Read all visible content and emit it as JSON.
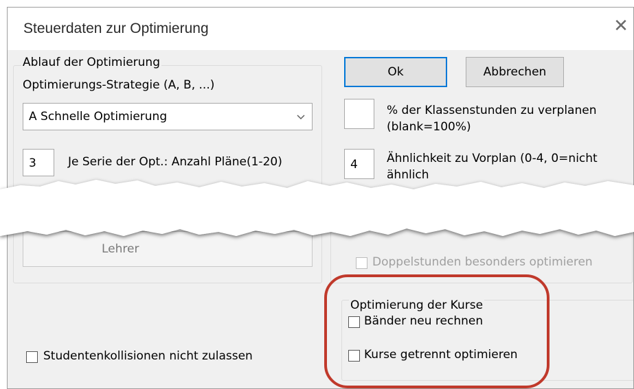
{
  "dialog": {
    "title": "Steuerdaten zur Optimierung",
    "close_glyph": "✕"
  },
  "ablauf_group": {
    "legend": "Ablauf der Optimierung",
    "strategy_label": "Optimierungs-Strategie (A, B, ...)",
    "strategy_value": "A Schnelle Optimierung",
    "plans_value": "3",
    "plans_label": "Je Serie der Opt.: Anzahl Pläne(1-20)",
    "lehrer_button_partial": "Lehrer"
  },
  "buttons": {
    "ok": "Ok",
    "cancel": "Abbrechen"
  },
  "klassenstunden": {
    "value": "",
    "label_line1": "% der Klassenstunden zu verplanen",
    "label_line2": "(blank=100%)"
  },
  "aehnlichkeit": {
    "value": "4",
    "label_line1": "Ähnlichkeit zu Vorplan (0-4, 0=nicht",
    "label_line2_partial": "ähnlich"
  },
  "doppelstunden": {
    "label": "Doppelstunden besonders optimieren",
    "checked": false,
    "enabled": false
  },
  "kurse_group": {
    "legend": "Optimierung der Kurse",
    "baender": {
      "label": "Bänder neu rechnen",
      "checked": false
    },
    "getrennt": {
      "label": "Kurse getrennt optimieren",
      "checked": false
    }
  },
  "studenten": {
    "label": "Studentenkollisionen nicht zulassen",
    "checked": false
  },
  "colors": {
    "dialog_bg": "#f0f0f0",
    "highlight": "#c0392b",
    "default_button_border": "#0078d7"
  },
  "icons": [
    "close-icon",
    "chevron-down-icon",
    "checkbox-icon"
  ]
}
